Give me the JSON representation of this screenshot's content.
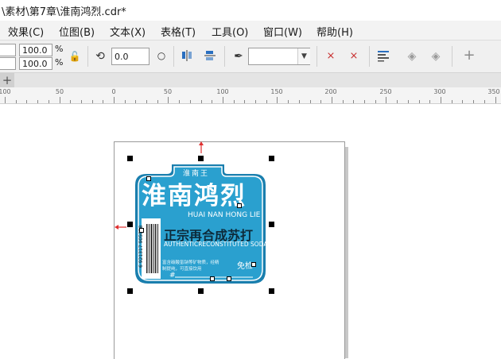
{
  "window": {
    "title": "\\素材\\第7章\\淮南鸿烈.cdr*"
  },
  "menu": [
    {
      "label": "效果(C)"
    },
    {
      "label": "位图(B)"
    },
    {
      "label": "文本(X)"
    },
    {
      "label": "表格(T)"
    },
    {
      "label": "工具(O)"
    },
    {
      "label": "窗口(W)"
    },
    {
      "label": "帮助(H)"
    }
  ],
  "toolbar": {
    "scale_x": "100.0",
    "scale_y": "100.0",
    "percent": "%",
    "rotation": "0.0",
    "outline_width": ""
  },
  "ruler": {
    "labels": [
      "100",
      "50",
      "0",
      "50",
      "100",
      "150",
      "200",
      "250",
      "300",
      "350"
    ]
  },
  "label": {
    "brand_small": "淮南王",
    "title": "淮南鸿烈",
    "pinyin": "HUAI NAN HONG LIE",
    "subtitle": "正宗再合成苏打",
    "english": "AUTHENTICRECONSTITUTED SODA",
    "barcode_digits": "6 921317 905038",
    "description": "富含碳酸氢钠等矿物质，经精制提纯，可直接饮用",
    "note": "免检",
    "hash": "#"
  },
  "colors": {
    "label_blue": "#2aa0cf",
    "label_dark": "#1a7fae",
    "handle": "#000000",
    "arrow": "#e03030"
  }
}
